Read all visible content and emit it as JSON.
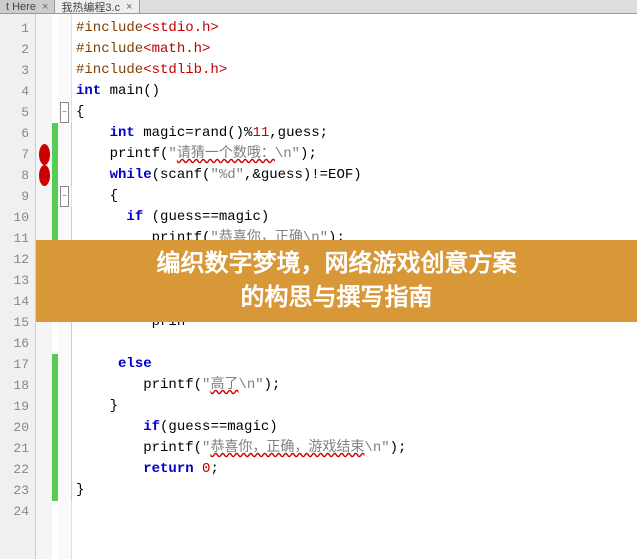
{
  "tabs": [
    {
      "label": "t Here",
      "active": false
    },
    {
      "label": "我热编程3.c",
      "active": true
    }
  ],
  "overlay": {
    "line1": "编织数字梦境，网络游戏创意方案",
    "line2": "的构思与撰写指南"
  },
  "code": {
    "lines": [
      {
        "n": 1,
        "text": "#include<stdio.h>",
        "type": "include"
      },
      {
        "n": 2,
        "text": "#include<math.h>",
        "type": "include"
      },
      {
        "n": 3,
        "text": "#include<stdlib.h>",
        "type": "include"
      },
      {
        "n": 4,
        "text": "int main()",
        "type": "sig"
      },
      {
        "n": 5,
        "text": "{",
        "type": "brace",
        "fold": "-"
      },
      {
        "n": 6,
        "text": "    int magic=rand()%11,guess;",
        "type": "decl",
        "green": true
      },
      {
        "n": 7,
        "text": "    printf(\"请猜一个数哦：\\n\");",
        "type": "printf",
        "bp": true,
        "green": true,
        "wavy": "请猜一个数哦："
      },
      {
        "n": 8,
        "text": "    while(scanf(\"%d\",&guess)!=EOF)",
        "type": "while",
        "bp": true,
        "green": true
      },
      {
        "n": 9,
        "text": "    {",
        "type": "brace",
        "fold": "-",
        "green": true
      },
      {
        "n": 10,
        "text": "      if (guess==magic)",
        "type": "if",
        "green": true
      },
      {
        "n": 11,
        "text": "         printf(\"恭喜你，正确\\n\");",
        "type": "printf",
        "green": true,
        "wavy": "恭喜你，正确"
      },
      {
        "n": 12,
        "text": "",
        "type": "blank"
      },
      {
        "n": 13,
        "text": "",
        "type": "blank"
      },
      {
        "n": 14,
        "text": "",
        "type": "blank"
      },
      {
        "n": 15,
        "text": "         prin",
        "type": "partial"
      },
      {
        "n": 16,
        "text": "",
        "type": "blank"
      },
      {
        "n": 17,
        "text": "     else",
        "type": "else",
        "green": true
      },
      {
        "n": 18,
        "text": "        printf(\"高了\\n\");",
        "type": "printf",
        "green": true,
        "wavy": "高了"
      },
      {
        "n": 19,
        "text": "    }",
        "type": "brace",
        "green": true
      },
      {
        "n": 20,
        "text": "        if(guess==magic)",
        "type": "if",
        "green": true
      },
      {
        "n": 21,
        "text": "        printf(\"恭喜你，正确，游戏结束\\n\");",
        "type": "printf",
        "green": true,
        "wavy": "恭喜你，正确，游戏结束"
      },
      {
        "n": 22,
        "text": "        return 0;",
        "type": "return",
        "green": true
      },
      {
        "n": 23,
        "text": "}",
        "type": "brace",
        "green": true
      },
      {
        "n": 24,
        "text": "",
        "type": "blank"
      }
    ]
  }
}
